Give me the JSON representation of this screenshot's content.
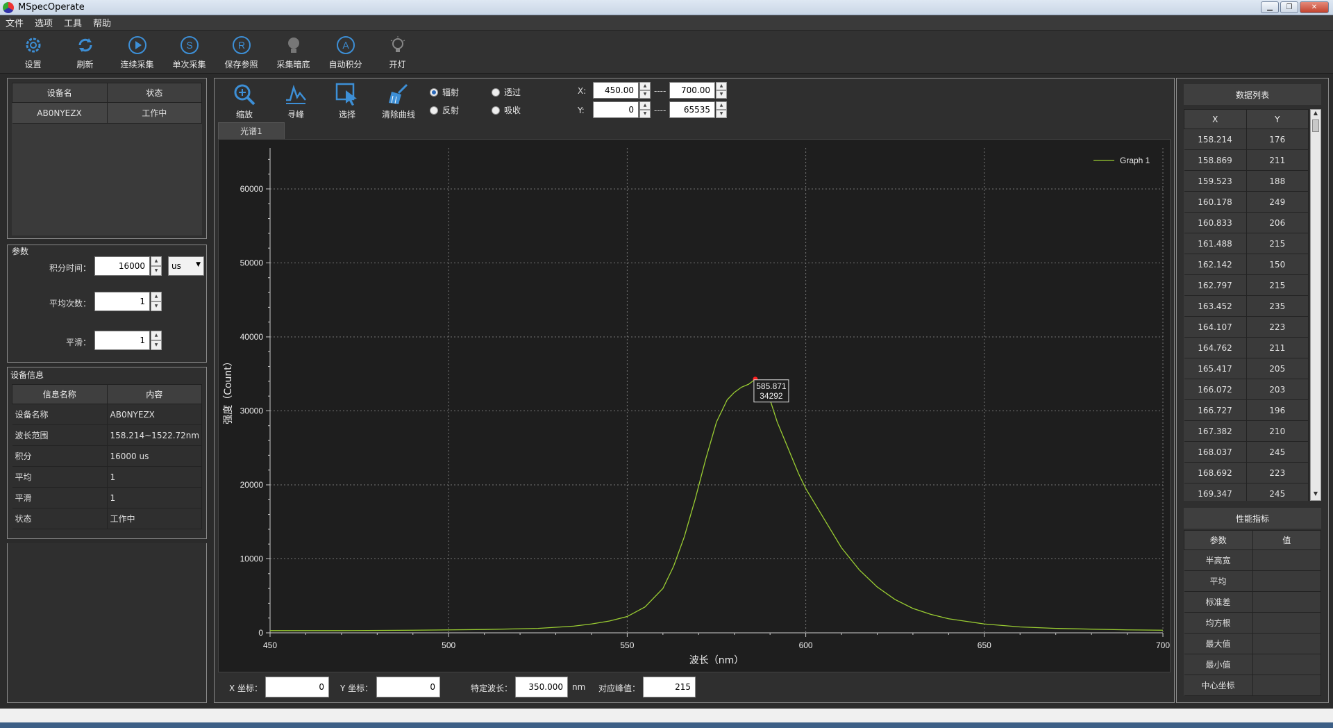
{
  "window": {
    "title": "MSpecOperate"
  },
  "menu": [
    "文件",
    "选项",
    "工具",
    "帮助"
  ],
  "toolbar": [
    {
      "label": "设置",
      "icon": "gear-icon"
    },
    {
      "label": "刷新",
      "icon": "refresh-icon"
    },
    {
      "label": "连续采集",
      "icon": "play-icon"
    },
    {
      "label": "单次采集",
      "icon": "single-capture-icon"
    },
    {
      "label": "保存参照",
      "icon": "save-reference-icon"
    },
    {
      "label": "采集暗底",
      "icon": "bulb-off-icon"
    },
    {
      "label": "自动积分",
      "icon": "auto-integration-icon"
    },
    {
      "label": "开灯",
      "icon": "bulb-on-icon"
    }
  ],
  "device_list": {
    "headers": [
      "设备名",
      "状态"
    ],
    "rows": [
      [
        "AB0NYEZX",
        "工作中"
      ]
    ]
  },
  "params": {
    "title": "参数",
    "integration_label": "积分时间：",
    "integration_value": "16000",
    "unit": "us",
    "average_label": "平均次数：",
    "average_value": "1",
    "smooth_label": "平滑：",
    "smooth_value": "1"
  },
  "device_info": {
    "title": "设备信息",
    "headers": [
      "信息名称",
      "内容"
    ],
    "rows": [
      [
        "设备名称",
        "AB0NYEZX"
      ],
      [
        "波长范围",
        "158.214~1522.72nm"
      ],
      [
        "积分",
        "16000 us"
      ],
      [
        "平均",
        "1"
      ],
      [
        "平滑",
        "1"
      ],
      [
        "状态",
        "工作中"
      ]
    ]
  },
  "chart_tools": [
    {
      "label": "缩放",
      "icon": "zoom-icon"
    },
    {
      "label": "寻峰",
      "icon": "peak-find-icon"
    },
    {
      "label": "选择",
      "icon": "select-cursor-icon"
    },
    {
      "label": "清除曲线",
      "icon": "clear-curve-icon"
    }
  ],
  "modes": {
    "emission": "辐射",
    "transmission": "透过",
    "reflection": "反射",
    "absorption": "吸收",
    "selected": "辐射"
  },
  "range": {
    "x_label": "X:",
    "x_min": "450.00",
    "x_max": "700.00",
    "y_label": "Y:",
    "y_min": "0",
    "y_max": "65535",
    "sep": "----"
  },
  "tab": "光谱1",
  "chart_data": {
    "type": "line",
    "xlabel": "波长（nm）",
    "ylabel": "强度（Count）",
    "xlim": [
      450,
      700
    ],
    "ylim": [
      0,
      65535
    ],
    "xticks": [
      450,
      500,
      550,
      600,
      650,
      700
    ],
    "yticks": [
      0,
      10000,
      20000,
      30000,
      40000,
      50000,
      60000
    ],
    "grid": true,
    "legend_position": "top-right",
    "series": [
      {
        "name": "Graph 1",
        "color": "#9acd32",
        "x": [
          450,
          470,
          490,
          510,
          525,
          535,
          540,
          545,
          550,
          555,
          560,
          563,
          566,
          569,
          572,
          575,
          578,
          580,
          582,
          584,
          585.871,
          588,
          590,
          592,
          595,
          598,
          600,
          605,
          610,
          615,
          620,
          625,
          630,
          635,
          640,
          650,
          660,
          670,
          680,
          690,
          700
        ],
        "y": [
          300,
          300,
          350,
          450,
          600,
          900,
          1200,
          1600,
          2200,
          3500,
          6000,
          9000,
          13000,
          18000,
          23500,
          28500,
          31500,
          32500,
          33200,
          33600,
          34292,
          33600,
          31500,
          28500,
          25000,
          21500,
          19500,
          15500,
          11500,
          8500,
          6200,
          4500,
          3300,
          2500,
          1900,
          1200,
          800,
          600,
          500,
          400,
          350
        ]
      }
    ],
    "annotation": {
      "x": 585.871,
      "y": 34292,
      "text_x": "585.871",
      "text_y": "34292"
    }
  },
  "bottom": {
    "x_coord_label": "X 坐标：",
    "x_coord": "0",
    "y_coord_label": "Y 坐标：",
    "y_coord": "0",
    "wavelength_label": "特定波长：",
    "wavelength": "350.000",
    "wavelength_unit": "nm",
    "peak_label": "对应峰值：",
    "peak": "215"
  },
  "data_list": {
    "title": "数据列表",
    "headers": [
      "X",
      "Y"
    ],
    "rows": [
      [
        "158.214",
        "176"
      ],
      [
        "158.869",
        "211"
      ],
      [
        "159.523",
        "188"
      ],
      [
        "160.178",
        "249"
      ],
      [
        "160.833",
        "206"
      ],
      [
        "161.488",
        "215"
      ],
      [
        "162.142",
        "150"
      ],
      [
        "162.797",
        "215"
      ],
      [
        "163.452",
        "235"
      ],
      [
        "164.107",
        "223"
      ],
      [
        "164.762",
        "211"
      ],
      [
        "165.417",
        "205"
      ],
      [
        "166.072",
        "203"
      ],
      [
        "166.727",
        "196"
      ],
      [
        "167.382",
        "210"
      ],
      [
        "168.037",
        "245"
      ],
      [
        "168.692",
        "223"
      ],
      [
        "169.347",
        "245"
      ]
    ]
  },
  "performance": {
    "title": "性能指标",
    "headers": [
      "参数",
      "值"
    ],
    "rows": [
      [
        "半高宽",
        ""
      ],
      [
        "平均",
        ""
      ],
      [
        "标准差",
        ""
      ],
      [
        "均方根",
        ""
      ],
      [
        "最大值",
        ""
      ],
      [
        "最小值",
        ""
      ],
      [
        "中心坐标",
        ""
      ]
    ]
  }
}
